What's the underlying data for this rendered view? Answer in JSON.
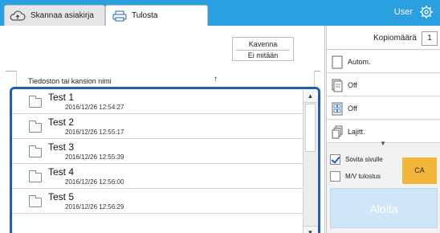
{
  "tabs": {
    "scan": {
      "label": "Skannaa asiakirja"
    },
    "print": {
      "label": "Tulosta"
    }
  },
  "header": {
    "user": "User"
  },
  "sort": {
    "mode": "Kavenna",
    "filter": "Ei mitään"
  },
  "list": {
    "column_header": "Tiedoston tai kansion nimi",
    "sort_arrow": "↑",
    "files": [
      {
        "name": "Test 1",
        "date": "2016/12/26 12:54:27"
      },
      {
        "name": "Test 2",
        "date": "2016/12/26 12:55:17"
      },
      {
        "name": "Test 3",
        "date": "2016/12/26 12:55:39"
      },
      {
        "name": "Test 4",
        "date": "2016/12/26 12:56:00"
      },
      {
        "name": "Test 5",
        "date": "2016/12/26 12:56:29"
      }
    ]
  },
  "settings": {
    "copies_label": "Kopiomäärä",
    "copies_value": "1",
    "options": [
      {
        "label": "Autom.",
        "icon": "paper-icon"
      },
      {
        "label": "Off",
        "icon": "duplex-icon"
      },
      {
        "label": "Off",
        "icon": "layout-icon"
      },
      {
        "label": "Lajitt.",
        "icon": "sort-icon"
      }
    ],
    "more_arrow": "▼",
    "fit_label": "Sovita sivulle",
    "fit_checked": true,
    "mv_label": "M/V tulostus",
    "mv_checked": false,
    "ca_label": "CA",
    "start_label": "Aloita"
  },
  "colors": {
    "topbar": "#2aa0e0",
    "list_border": "#1f5fb0",
    "ca_button": "#f2b63b",
    "start_button": "#cfe6f7"
  }
}
